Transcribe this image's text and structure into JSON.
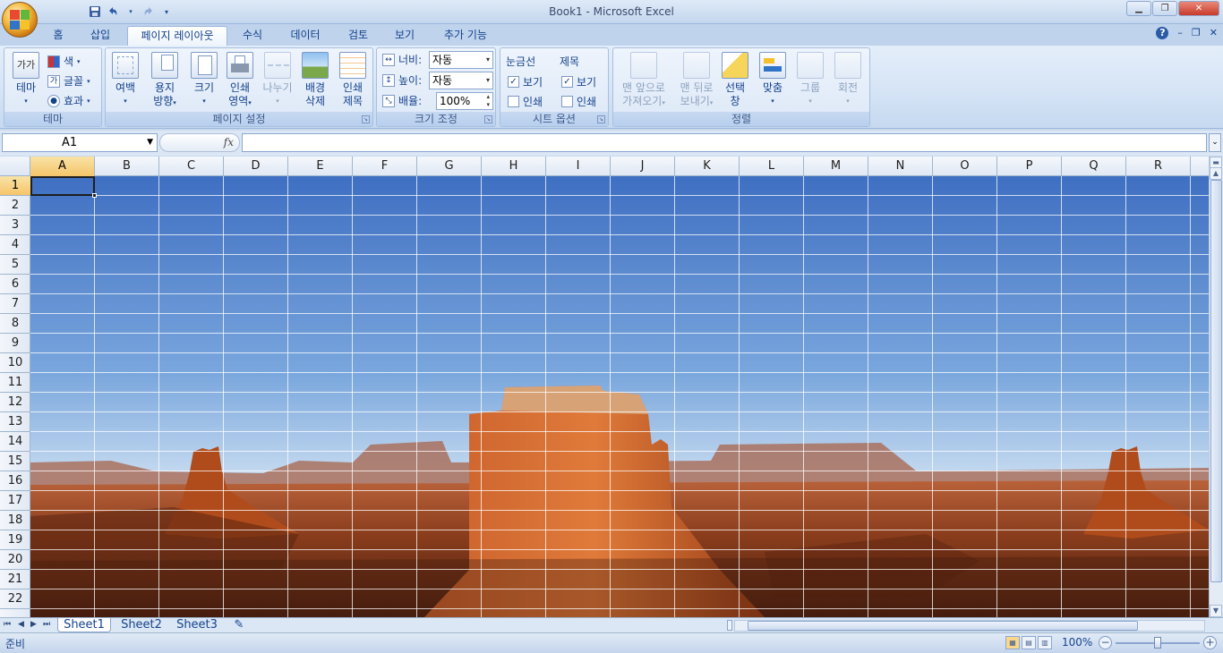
{
  "window": {
    "title": "Book1 - Microsoft Excel"
  },
  "qat": {
    "icons": [
      "save-icon",
      "undo-icon",
      "redo-icon",
      "customize-icon"
    ]
  },
  "tabs": [
    {
      "label": "홈"
    },
    {
      "label": "삽입"
    },
    {
      "label": "페이지 레이아웃",
      "active": true
    },
    {
      "label": "수식"
    },
    {
      "label": "데이터"
    },
    {
      "label": "검토"
    },
    {
      "label": "보기"
    },
    {
      "label": "추가 기능"
    }
  ],
  "ribbon": {
    "theme": {
      "label": "테마",
      "theme_btn": "테마",
      "colors": "색",
      "fonts": "글꼴",
      "effects": "효과"
    },
    "page_setup": {
      "label": "페이지 설정",
      "margins": "여백",
      "orientation_1": "용지",
      "orientation_2": "방향",
      "size": "크기",
      "print_area_1": "인쇄",
      "print_area_2": "영역",
      "breaks": "나누기",
      "background_1": "배경",
      "background_2": "삭제",
      "print_titles_1": "인쇄",
      "print_titles_2": "제목"
    },
    "scale": {
      "label": "크기 조정",
      "width_label": "너비:",
      "width_value": "자동",
      "height_label": "높이:",
      "height_value": "자동",
      "scale_label": "배율:",
      "scale_value": "100%"
    },
    "sheet_options": {
      "label": "시트 옵션",
      "gridlines": "눈금선",
      "headings": "제목",
      "view": "보기",
      "print": "인쇄",
      "gridlines_view": true,
      "gridlines_print": false,
      "headings_view": true,
      "headings_print": false
    },
    "arrange": {
      "label": "정렬",
      "bring_front_1": "맨 앞으로",
      "bring_front_2": "가져오기",
      "send_back_1": "맨 뒤로",
      "send_back_2": "보내기",
      "selection_1": "선택",
      "selection_2": "창",
      "align": "맞춤",
      "group": "그룹",
      "rotate": "회전"
    }
  },
  "formula_bar": {
    "name_box": "A1",
    "fx": "fx",
    "content": ""
  },
  "grid": {
    "columns": [
      "A",
      "B",
      "C",
      "D",
      "E",
      "F",
      "G",
      "H",
      "I",
      "J",
      "K",
      "L",
      "M",
      "N",
      "O",
      "P",
      "Q",
      "R"
    ],
    "rows": [
      "1",
      "2",
      "3",
      "4",
      "5",
      "6",
      "7",
      "8",
      "9",
      "10",
      "11",
      "12",
      "13",
      "14",
      "15",
      "16",
      "17",
      "18",
      "19",
      "20",
      "21",
      "22"
    ],
    "selected_cell": "A1"
  },
  "sheets": [
    {
      "name": "Sheet1",
      "active": true
    },
    {
      "name": "Sheet2"
    },
    {
      "name": "Sheet3"
    }
  ],
  "status": {
    "text": "준비",
    "zoom": "100%",
    "zoom_level": 0.5
  },
  "colors": {
    "accent": "#15428b",
    "selection_header": "#f5c56a",
    "sky": "#4a79c6",
    "rock": "#b8521f"
  }
}
